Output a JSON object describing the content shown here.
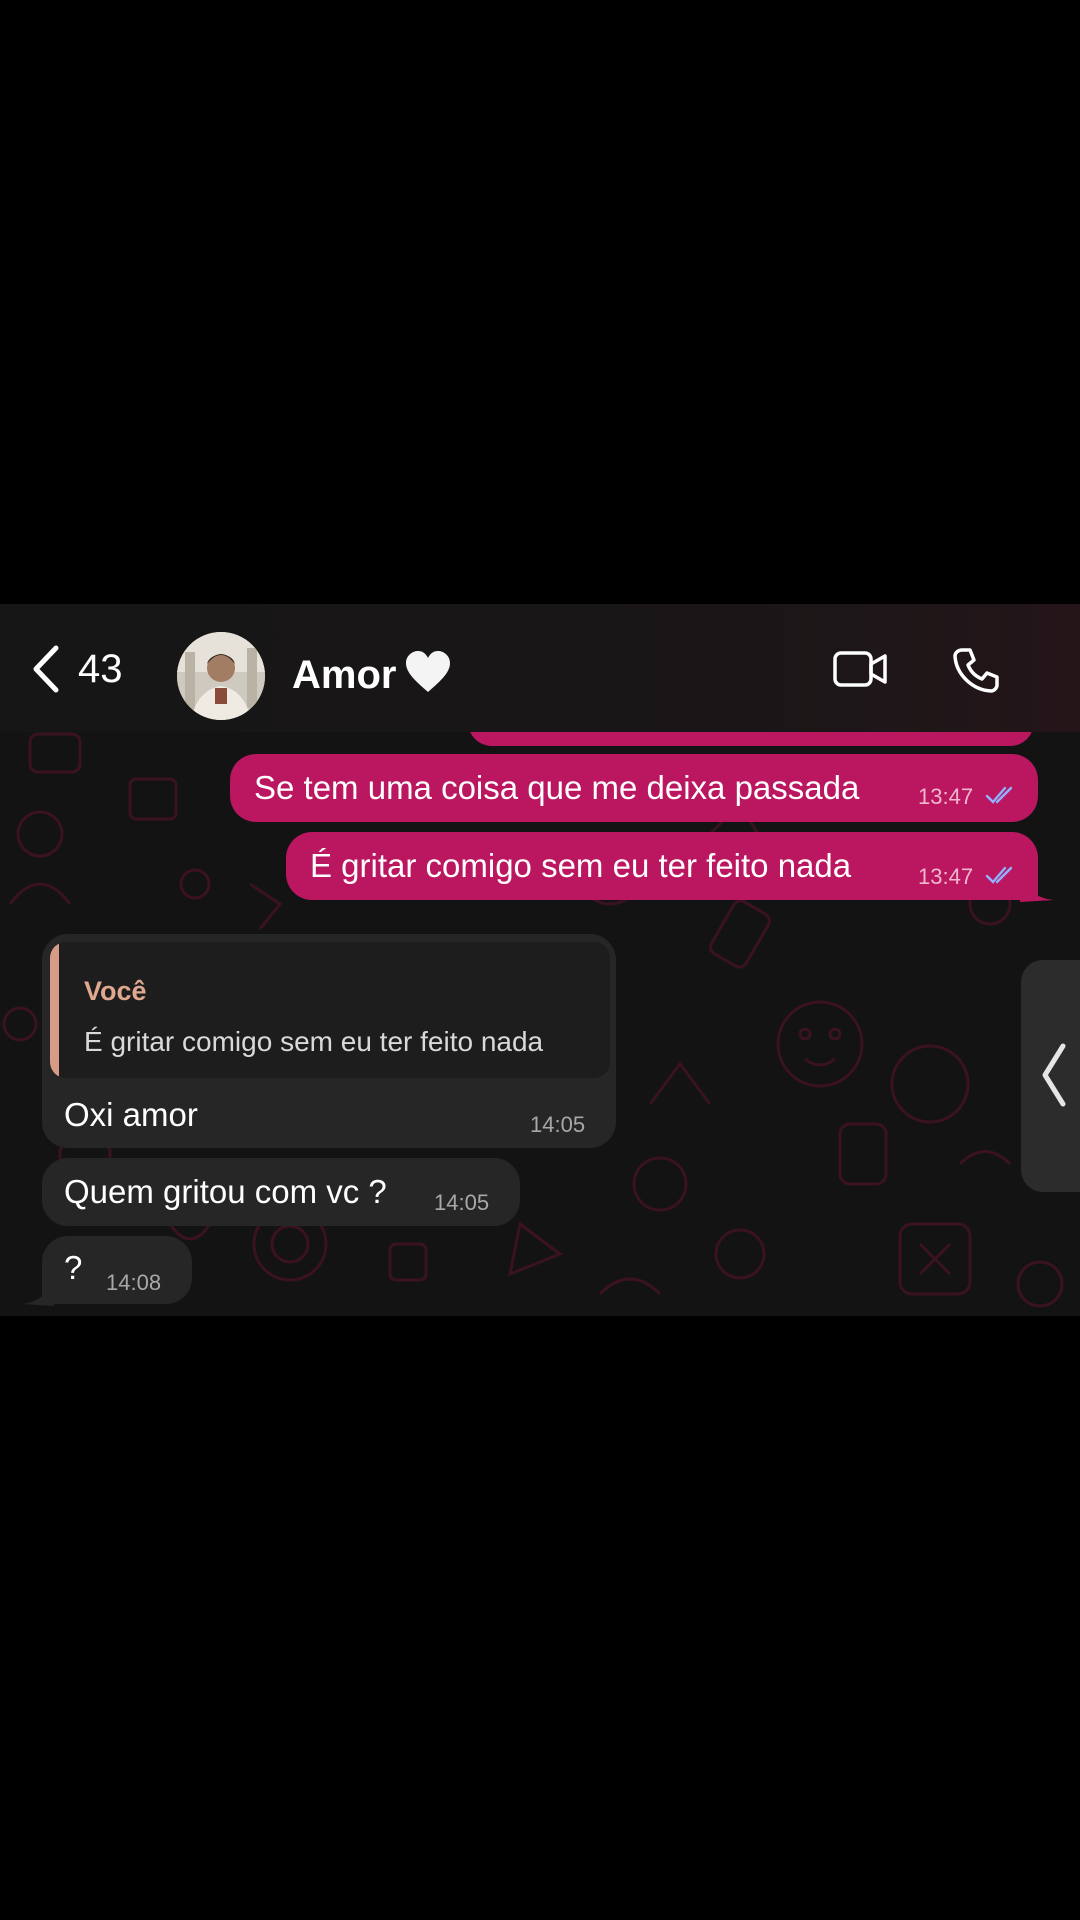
{
  "header": {
    "back_count": "43",
    "contact_name": "Amor",
    "contact_emoji": "white-heart"
  },
  "messages": [
    {
      "direction": "outgoing",
      "text": "Se tem uma coisa que me deixa passada",
      "time": "13:47",
      "status": "read"
    },
    {
      "direction": "outgoing",
      "text": "É gritar comigo sem eu ter feito nada",
      "time": "13:47",
      "status": "read"
    },
    {
      "direction": "incoming",
      "quote": {
        "author": "Você",
        "text": "É gritar comigo sem eu ter feito nada"
      },
      "text": "Oxi amor",
      "time": "14:05"
    },
    {
      "direction": "incoming",
      "text": "Quem gritou com vc ?",
      "time": "14:05"
    },
    {
      "direction": "incoming",
      "text": "?",
      "time": "14:08"
    }
  ],
  "icons": [
    "chevron-left-icon",
    "video-camera-icon",
    "phone-icon",
    "double-check-icon",
    "white-heart-icon",
    "chevron-left-handle-icon"
  ],
  "colors": {
    "outgoing_bubble": "#bb1660",
    "incoming_bubble": "#262626",
    "quote_accent": "#d89c86",
    "read_ticks": "#8fb4ff",
    "background": "#131313"
  }
}
